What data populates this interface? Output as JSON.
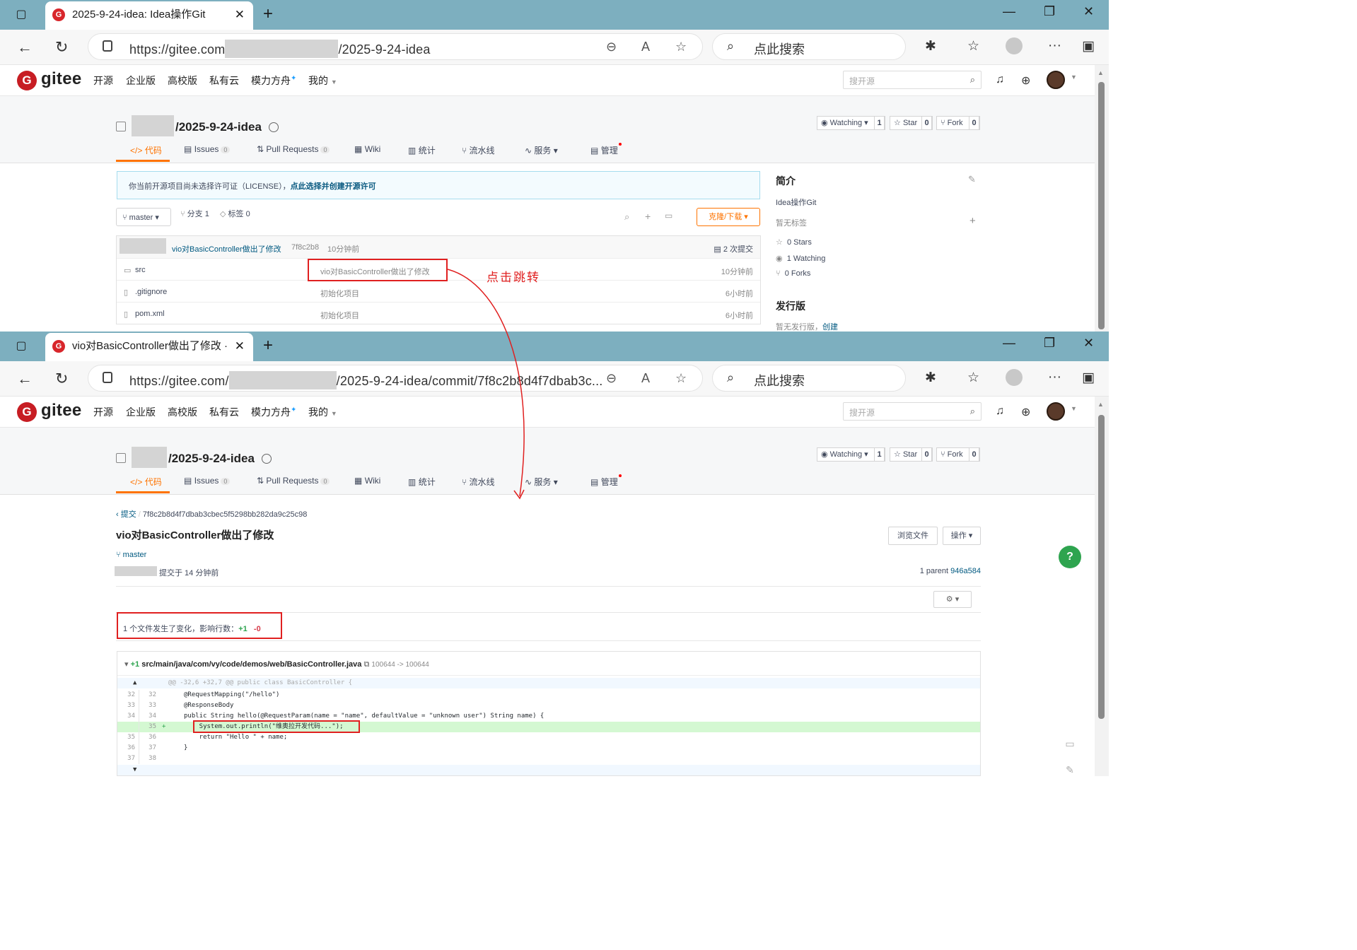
{
  "window1": {
    "tab_title": "2025-9-24-idea: Idea操作Git",
    "url_prefix": "https://gitee.com",
    "url_suffix": "/2025-9-24-idea",
    "browser_search": "点此搜索"
  },
  "window2": {
    "tab_title": "vio对BasicController做出了修改 ·",
    "url_prefix": "https://gitee.com/",
    "url_suffix": "/2025-9-24-idea/commit/7f8c2b8d4f7dbab3c...",
    "browser_search": "点此搜索"
  },
  "gitee_nav": {
    "logo": "gitee",
    "items": [
      "开源",
      "企业版",
      "高校版",
      "私有云",
      "模力方舟",
      "我的"
    ],
    "search_placeholder": "搜开源"
  },
  "project": {
    "name": "/2025-9-24-idea",
    "watching_label": "Watching",
    "watching_count": "1",
    "star_label": "Star",
    "star_count": "0",
    "fork_label": "Fork",
    "fork_count": "0",
    "tabs": [
      {
        "label": "代码",
        "count": ""
      },
      {
        "label": "Issues",
        "count": "0"
      },
      {
        "label": "Pull Requests",
        "count": "0"
      },
      {
        "label": "Wiki",
        "count": ""
      },
      {
        "label": "统计",
        "count": ""
      },
      {
        "label": "流水线",
        "count": ""
      },
      {
        "label": "服务",
        "count": ""
      },
      {
        "label": "管理",
        "count": ""
      }
    ]
  },
  "repo_page": {
    "license_notice": "你当前开源项目尚未选择许可证（LICENSE），",
    "license_link": "点此选择并创建开源许可",
    "branch": "master",
    "branches": "分支 1",
    "tags": "标签 0",
    "clone_button": "克隆/下载",
    "last_commit_msg": "vio对BasicController做出了修改",
    "last_commit_hash": "7f8c2b8",
    "last_commit_time": "10分钟前",
    "commit_count": "2 次提交",
    "files": [
      {
        "name": "src",
        "message": "vio对BasicController做出了修改",
        "time": "10分钟前"
      },
      {
        "name": ".gitignore",
        "message": "初始化项目",
        "time": "6小时前"
      },
      {
        "name": "pom.xml",
        "message": "初始化项目",
        "time": "6小时前"
      }
    ],
    "sidebar": {
      "intro_title": "简介",
      "description": "Idea操作Git",
      "no_tags": "暂无标签",
      "stars": "0 Stars",
      "watching": "1 Watching",
      "forks": "0 Forks",
      "release_title": "发行版",
      "no_release": "暂无发行版，",
      "create_link": "创建"
    }
  },
  "annotation": "点击跳转",
  "commit_page": {
    "crumb_back": "提交",
    "commit_hash": "7f8c2b8d4f7dbab3cbec5f5298bb282da9c25c98",
    "title": "vio对BasicController做出了修改",
    "browse_files": "浏览文件",
    "actions": "操作",
    "branch": "master",
    "committed": "提交于 14 分钟前",
    "parent_label": "1 parent",
    "parent_hash": "946a584",
    "summary_text": "1 个文件发生了变化，影响行数：",
    "additions": "+1",
    "deletions": "-0",
    "file_additions": "+1",
    "file_path": "src/main/java/com/vy/code/demos/web/BasicController.java",
    "file_mode": "100644 -> 100644",
    "hunk": "@@ -32,6 +32,7 @@ public class BasicController {",
    "lines": [
      {
        "old": "32",
        "new": "32",
        "code": "@RequestMapping(\"/hello\")"
      },
      {
        "old": "33",
        "new": "33",
        "code": "@ResponseBody"
      },
      {
        "old": "34",
        "new": "34",
        "code": "public String hello(@RequestParam(name = \"name\", defaultValue = \"unknown user\") String name) {"
      },
      {
        "old": "",
        "new": "35",
        "code": "    System.out.println(\"维奥拉开发代码...\");"
      },
      {
        "old": "35",
        "new": "36",
        "code": "    return \"Hello \" + name;"
      },
      {
        "old": "36",
        "new": "37",
        "code": "}"
      },
      {
        "old": "37",
        "new": "38",
        "code": ""
      }
    ],
    "help": "?"
  }
}
